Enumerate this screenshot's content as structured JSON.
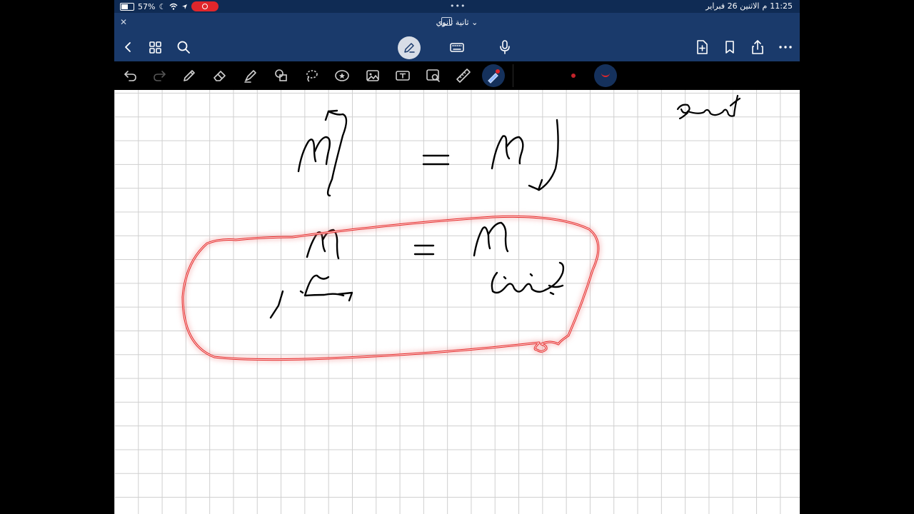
{
  "status": {
    "time": "11:25",
    "date": "الاثنين 26 فبراير",
    "ampm": "م",
    "battery": "57%",
    "icons": [
      "battery-icon",
      "moon-icon",
      "wifi-icon",
      "location-icon",
      "screen-record-icon"
    ]
  },
  "titlebar": {
    "title": "ثانية ثانوي ⌄"
  },
  "toolbar": {
    "left": [
      "back-icon",
      "grid-icon",
      "search-icon"
    ],
    "center": [
      "pen-mode-icon",
      "keyboard-icon",
      "microphone-icon"
    ],
    "right": [
      "add-page-icon",
      "bookmark-icon",
      "share-icon",
      "more-icon"
    ]
  },
  "tools": {
    "items": [
      "undo-icon",
      "redo-icon",
      "pen-icon",
      "eraser-icon",
      "highlighter-icon",
      "shapes-icon",
      "lasso-icon",
      "sticker-icon",
      "image-icon",
      "text-icon",
      "zoom-window-icon",
      "ruler-icon",
      "laser-pointer-icon"
    ],
    "selected_color": "#c3232a",
    "accent": "#1a3a6b"
  },
  "note": {
    "handwriting": [
      "مبدأ",
      "M",
      "=",
      "M",
      "M",
      "=",
      "M",
      "يسار",
      "يمين"
    ]
  }
}
